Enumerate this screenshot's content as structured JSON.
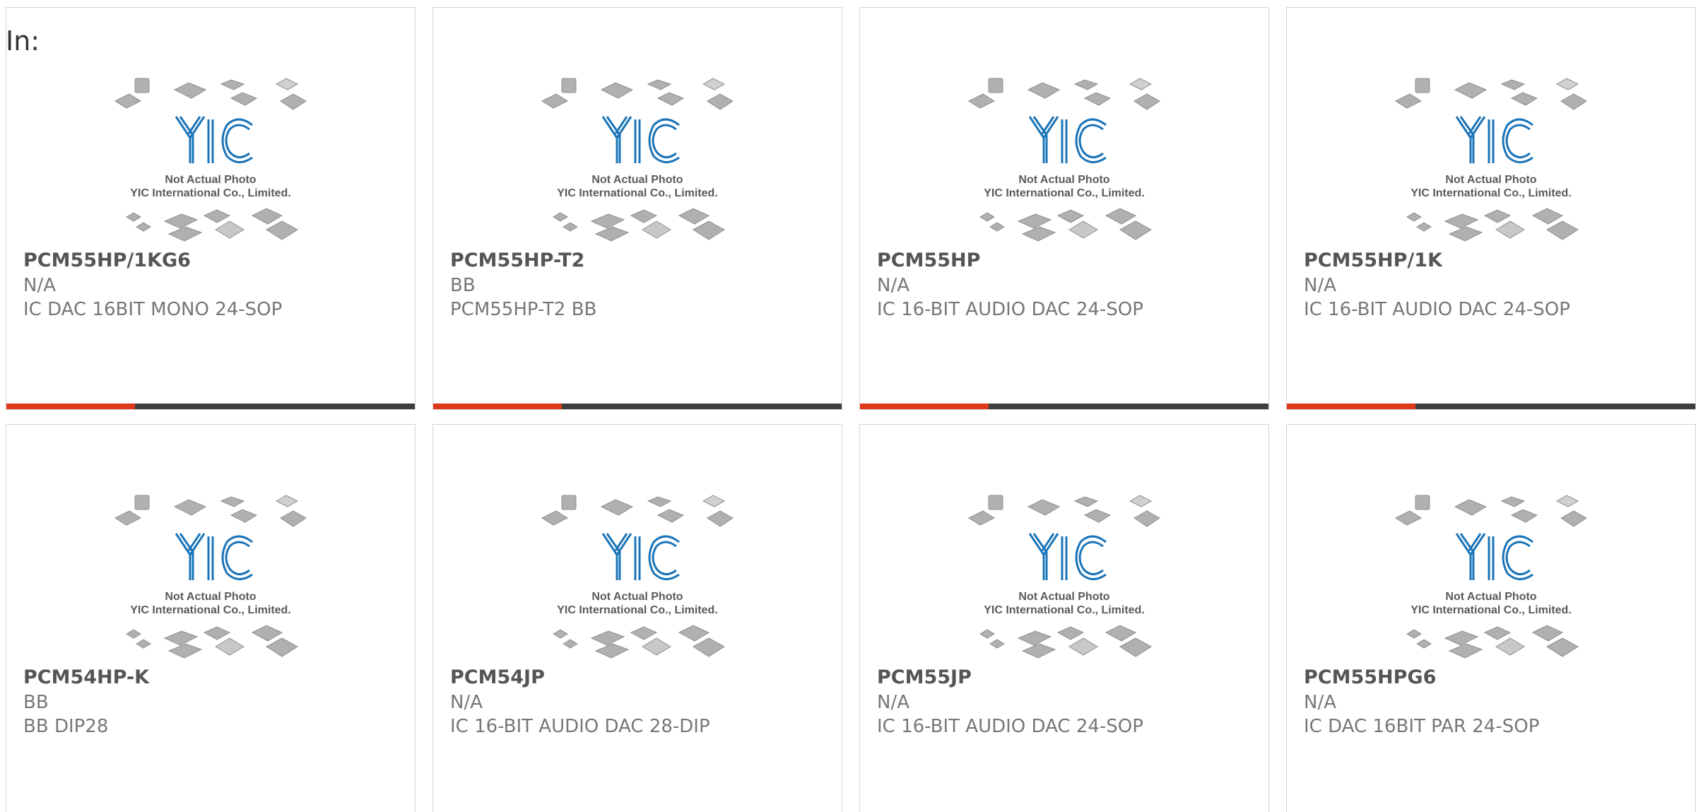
{
  "header": {
    "in_label": "In:"
  },
  "placeholder": {
    "line1": "Not Actual Photo",
    "line2": "YIC International Co., Limited.",
    "logo": "YIC"
  },
  "colors": {
    "accent": "#e0381a",
    "bar": "#3f3f3f",
    "logo": "#1a74b8",
    "chip": "#a8a8a8"
  },
  "products": [
    {
      "part": "PCM55HP/1KG6",
      "manufacturer": "N/A",
      "description": "IC DAC 16BIT MONO 24-SOP"
    },
    {
      "part": "PCM55HP-T2",
      "manufacturer": "BB",
      "description": "PCM55HP-T2 BB"
    },
    {
      "part": "PCM55HP",
      "manufacturer": "N/A",
      "description": "IC 16-BIT AUDIO DAC 24-SOP"
    },
    {
      "part": "PCM55HP/1K",
      "manufacturer": "N/A",
      "description": "IC 16-BIT AUDIO DAC 24-SOP"
    },
    {
      "part": "PCM54HP-K",
      "manufacturer": "BB",
      "description": "BB DIP28"
    },
    {
      "part": "PCM54JP",
      "manufacturer": "N/A",
      "description": "IC 16-BIT AUDIO DAC 28-DIP"
    },
    {
      "part": "PCM55JP",
      "manufacturer": "N/A",
      "description": "IC 16-BIT AUDIO DAC 24-SOP"
    },
    {
      "part": "PCM55HPG6",
      "manufacturer": "N/A",
      "description": "IC DAC 16BIT PAR 24-SOP"
    }
  ]
}
